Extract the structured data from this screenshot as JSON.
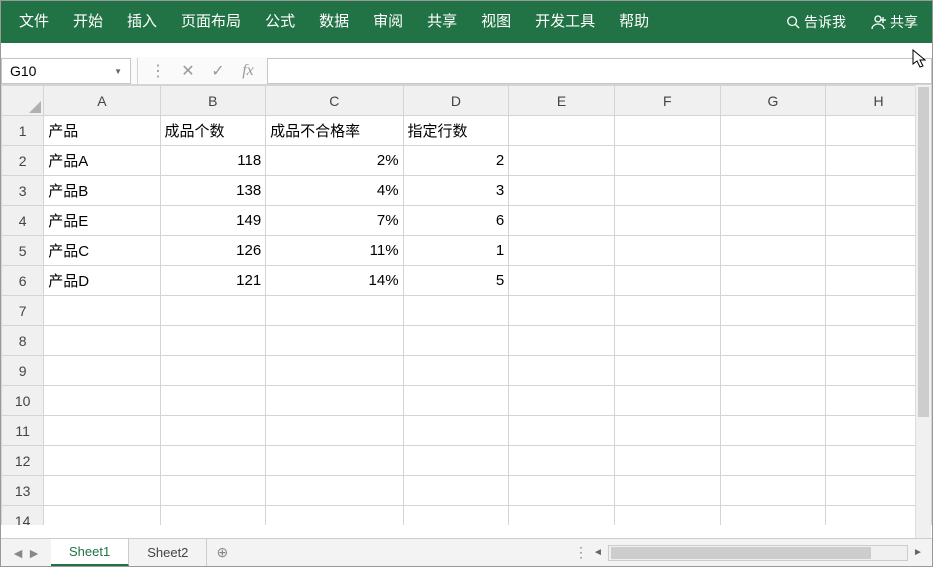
{
  "ribbon": {
    "tabs": [
      "文件",
      "开始",
      "插入",
      "页面布局",
      "公式",
      "数据",
      "审阅",
      "共享",
      "视图",
      "开发工具",
      "帮助"
    ],
    "tellme": "告诉我",
    "share": "共享"
  },
  "namebox": {
    "value": "G10"
  },
  "formula": {
    "value": ""
  },
  "columns": [
    "A",
    "B",
    "C",
    "D",
    "E",
    "F",
    "G",
    "H"
  ],
  "rows": [
    "1",
    "2",
    "3",
    "4",
    "5",
    "6",
    "7",
    "8",
    "9",
    "10",
    "11",
    "12",
    "13",
    "14"
  ],
  "cells": {
    "header": {
      "A": "产品",
      "B": "成品个数",
      "C": "成品不合格率",
      "D": "指定行数"
    },
    "data": [
      {
        "A": "产品A",
        "B": "118",
        "C": "2%",
        "D": "2"
      },
      {
        "A": "产品B",
        "B": "138",
        "C": "4%",
        "D": "3"
      },
      {
        "A": "产品E",
        "B": "149",
        "C": "7%",
        "D": "6"
      },
      {
        "A": "产品C",
        "B": "126",
        "C": "11%",
        "D": "1"
      },
      {
        "A": "产品D",
        "B": "121",
        "C": "14%",
        "D": "5"
      }
    ]
  },
  "sheets": {
    "active": "Sheet1",
    "tabs": [
      "Sheet1",
      "Sheet2"
    ]
  }
}
